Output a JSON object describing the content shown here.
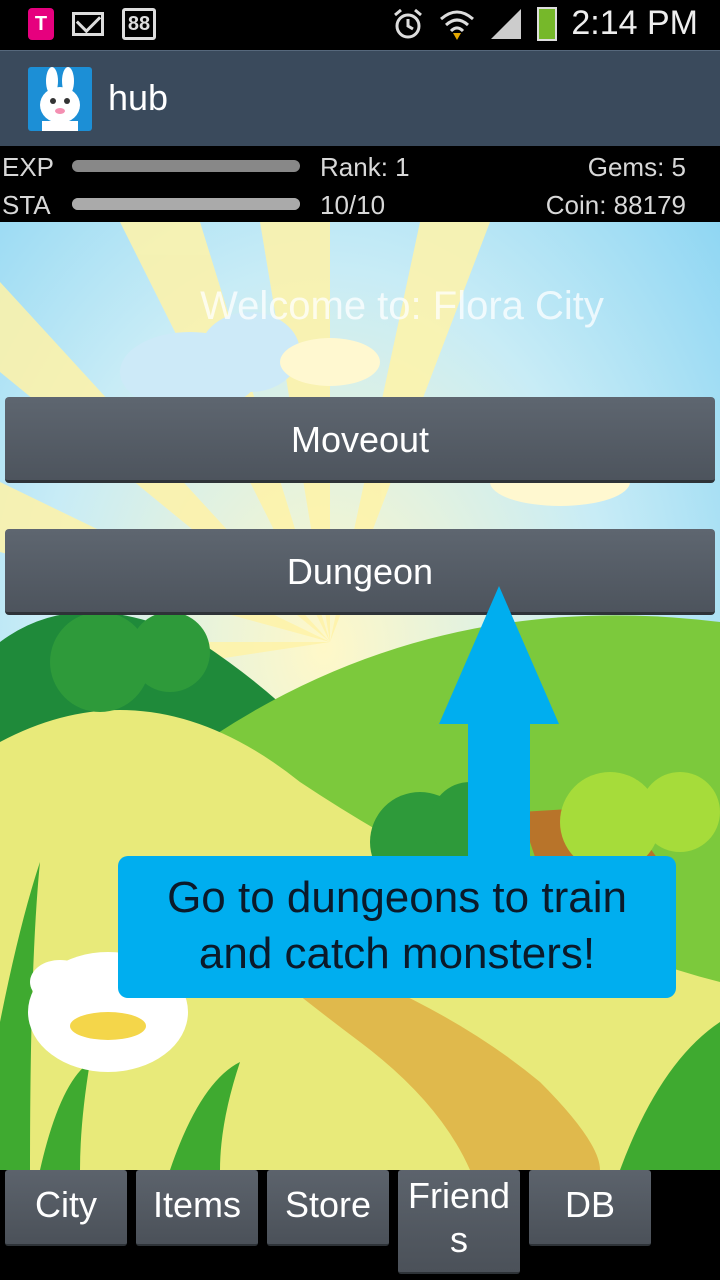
{
  "status_bar": {
    "carrier_icon": "tmobile-icon",
    "notification_badge": "88",
    "time": "2:14 PM",
    "icons": [
      "alarm-icon",
      "wifi-icon",
      "signal-icon",
      "battery-icon"
    ],
    "battery_color": "#76b82a"
  },
  "action_bar": {
    "title": "hub",
    "app_icon": "bunny-app-icon",
    "color": "#3a4a5c"
  },
  "stats": {
    "exp_label": "EXP",
    "sta_label": "STA",
    "exp_progress": 0,
    "sta_progress": 1.0,
    "rank": "Rank: 1",
    "sta_value": "10/10",
    "gems": "Gems: 5",
    "coin": "Coin: 88179"
  },
  "main": {
    "welcome": "Welcome to: Flora City",
    "buttons": [
      {
        "label": "Moveout"
      },
      {
        "label": "Dungeon"
      }
    ],
    "tooltip": {
      "line1": "Go to dungeons to train",
      "line2": "and catch monsters!",
      "color": "#00aeef"
    }
  },
  "tabs": [
    {
      "label": "City"
    },
    {
      "label": "Items"
    },
    {
      "label": "Store"
    },
    {
      "label": "Friend",
      "label2": "s"
    },
    {
      "label": "DB"
    }
  ]
}
